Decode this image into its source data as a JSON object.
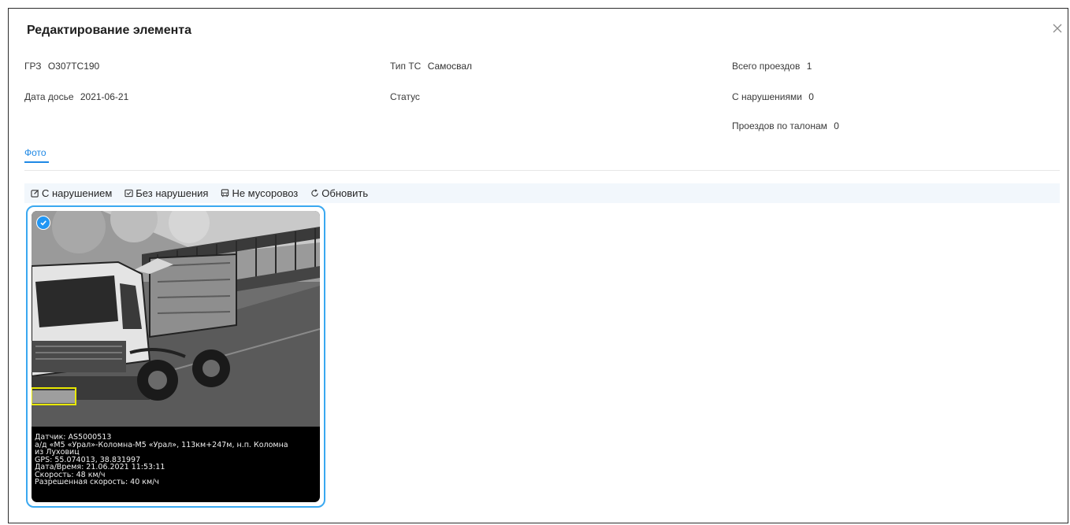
{
  "dialog": {
    "title": "Редактирование элемента"
  },
  "fields": {
    "grz": {
      "label": "ГРЗ",
      "value": "О307ТС190"
    },
    "dossier_date": {
      "label": "Дата досье",
      "value": "2021-06-21"
    },
    "vehicle_type": {
      "label": "Тип ТС",
      "value": "Самосвал"
    },
    "status": {
      "label": "Статус",
      "value": ""
    },
    "total_passes": {
      "label": "Всего проездов",
      "value": "1"
    },
    "violations": {
      "label": "С нарушениями",
      "value": "0"
    },
    "ticket_passes": {
      "label": "Проездов по талонам",
      "value": "0"
    }
  },
  "tabs": [
    {
      "label": "Фото",
      "active": true
    }
  ],
  "toolbar": {
    "with_violation": "С нарушением",
    "no_violation": "Без нарушения",
    "not_garbage_truck": "Не мусоровоз",
    "refresh": "Обновить"
  },
  "photo": {
    "selected": true,
    "caption": [
      "Датчик: AS5000513",
      "а/д «М5 «Урал»-Коломна-М5 «Урал», 113км+247м, н.п. Коломна",
      "из Луховиц",
      "GPS: 55.074013, 38.831997",
      "Дата/Время: 21.06.2021 11:53:11",
      "Скорость: 48 км/ч",
      "Разрешенная скорость: 40 км/ч"
    ]
  },
  "colors": {
    "accent": "#1e88e5",
    "card_border": "#3aa8f0",
    "plate_box": "#e8e800"
  }
}
